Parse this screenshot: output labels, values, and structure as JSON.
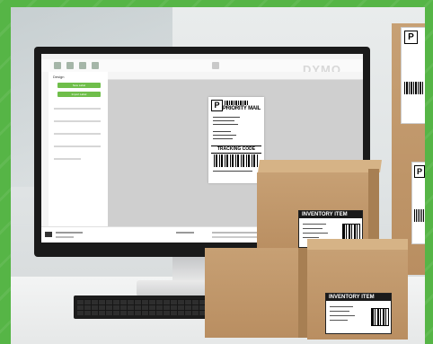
{
  "scene": {
    "brand_text": "DYMO",
    "colors": {
      "frame_green": "#56b546",
      "accent_green": "#6fbe4a",
      "cardboard": "#c7a074"
    }
  },
  "screen": {
    "panel_title": "Design",
    "primary_button": "New Label",
    "secondary_button": "Import Label",
    "label_preview": {
      "service_mark": "P",
      "service_name": "PRIORITY MAIL",
      "tracking_heading": "TRACKING CODE"
    }
  },
  "inventory_label_text": "INVENTORY ITEM",
  "shipping_mark": "P"
}
